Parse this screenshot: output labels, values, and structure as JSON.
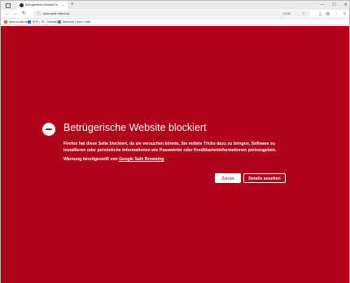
{
  "browser": {
    "tab": {
      "title": "Betrügerische Website bl",
      "close": "×"
    },
    "new_tab": "+",
    "window_controls": [
      "—",
      "☐",
      "✕"
    ],
    "nav": {
      "back": "←",
      "forward": "→",
      "reload": "↻",
      "url": "microsoft-office.de",
      "zoom": "110%",
      "star": "☆"
    },
    "toolbar_icons": [
      "⤓",
      "▤",
      "⋮",
      "≡"
    ],
    "bookmarks": [
      {
        "label": "www.ecodia.net",
        "color": "#e0701a"
      },
      {
        "label": "ISTE | TR - Sammlung",
        "color": "#3a6fd1"
      },
      {
        "label": "Welcome | Saxo | Web",
        "color": "#7a7a7a"
      }
    ]
  },
  "page": {
    "title": "Betrügerische Website blockiert",
    "description": "Firefox hat diese Seite blockiert, da sie versuchen könnte, Sie mittels Tricks dazu zu bringen, Software zu installieren oder persönliche Informationen wie Passwörter oder Kreditkarteninformationen preiszugeben.",
    "provider_prefix": "Warnung bereitgestellt von ",
    "provider_link": "Google Safe Browsing",
    "back_button": "Zurück",
    "details_button": "Details ansehen",
    "background_color": "#b1001b"
  }
}
